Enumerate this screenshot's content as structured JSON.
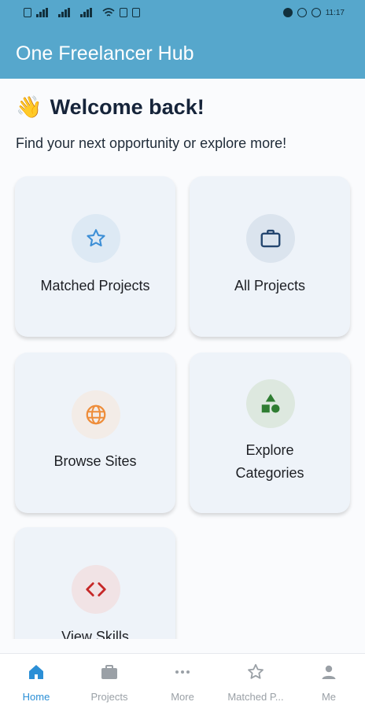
{
  "app": {
    "title": "One Freelancer Hub"
  },
  "status_bar": {
    "time": "11:17"
  },
  "welcome": {
    "emoji": "👋",
    "heading": "Welcome back!",
    "subtitle": "Find your next opportunity or explore more!"
  },
  "cards": [
    {
      "label": "Matched Projects",
      "icon": "star-icon",
      "icon_color": "#3d8fd6",
      "circle_color": "#dde9f4"
    },
    {
      "label": "All Projects",
      "icon": "briefcase-icon",
      "icon_color": "#24466f",
      "circle_color": "#dbe4ee"
    },
    {
      "label": "Browse Sites",
      "icon": "globe-icon",
      "icon_color": "#ee8d3a",
      "circle_color": "#f3ece7"
    },
    {
      "label_line1": "Explore",
      "label_line2": "Categories",
      "icon": "shapes-icon",
      "icon_color": "#2f7d32",
      "circle_color": "#dde8df"
    },
    {
      "label": "View Skills",
      "icon": "code-icon",
      "icon_color": "#c62828",
      "circle_color": "#f1e3e5"
    }
  ],
  "bottom_nav": {
    "items": [
      {
        "label": "Home",
        "icon": "home-icon",
        "active": true
      },
      {
        "label": "Projects",
        "icon": "briefcase-icon"
      },
      {
        "label": "More",
        "icon": "more-dots-icon"
      },
      {
        "label": "Matched P...",
        "icon": "star-outline-icon"
      },
      {
        "label": "Me",
        "icon": "person-icon"
      }
    ],
    "active_color": "#2b8fd6",
    "inactive_color": "#9aa0a6"
  },
  "colors": {
    "app_bar": "#56a7cc",
    "card_bg": "#eef3f9"
  }
}
